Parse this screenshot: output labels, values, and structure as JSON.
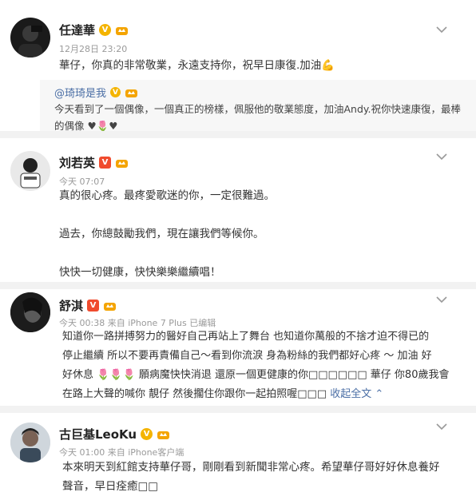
{
  "posts": [
    {
      "name": "任達華",
      "meta": "12月28日 23:20",
      "text": "華仔，你真的非常敬業，永遠支持你，祝早日康復.加油💪",
      "repost": {
        "name": "@琦琦是我",
        "text": "今天看到了一個偶像，一個真正的榜樣，佩服他的敬業態度，加油Andy.祝你快速康復，最棒的偶像 ♥🌷♥"
      }
    },
    {
      "name": "刘若英",
      "meta": "今天 07:07",
      "lines": [
        "真的很心疼。最疼愛歌迷的你，一定很難過。",
        "",
        "過去，你總鼓勵我們，現在讓我們等候你。",
        "",
        "快快一切健康，快快樂樂繼續唱！"
      ]
    },
    {
      "name": "舒淇",
      "meta": "今天 00:38 来自 iPhone 7 Plus   已编辑",
      "lines": [
        "知道你一路拼搏努力的醫好自己再站上了舞台 也知道你萬般的不捨才迫不得已的",
        "停止繼續 所以不要再責備自己～看到你流淚 身為粉絲的我們都好心疼 ～ 加油 好",
        "好休息 🌷🌷🌷 願病魔快快消退 還原一個更健康的你□□□□□□ 華仔 你80歲我會",
        "在路上大聲的喊你 靚仔 然後擱住你跟你一起拍照喔□□□ "
      ],
      "collapse": "收起全文 ⌃"
    },
    {
      "name": "古巨基LeoKu",
      "meta": "今天 01:00 来自 iPhone客户端",
      "lines": [
        "本來明天到紅館支持華仔哥，剛剛看到新聞非常心疼。希望華仔哥好好休息養好",
        "聲音，早日痊癒□□"
      ]
    }
  ],
  "badges": {
    "v_label": "V"
  },
  "colors": {
    "link": "#4a6ea5",
    "meta": "#9a9a9a",
    "badge_gold": "#f4b400",
    "badge_red": "#f04b2e"
  }
}
